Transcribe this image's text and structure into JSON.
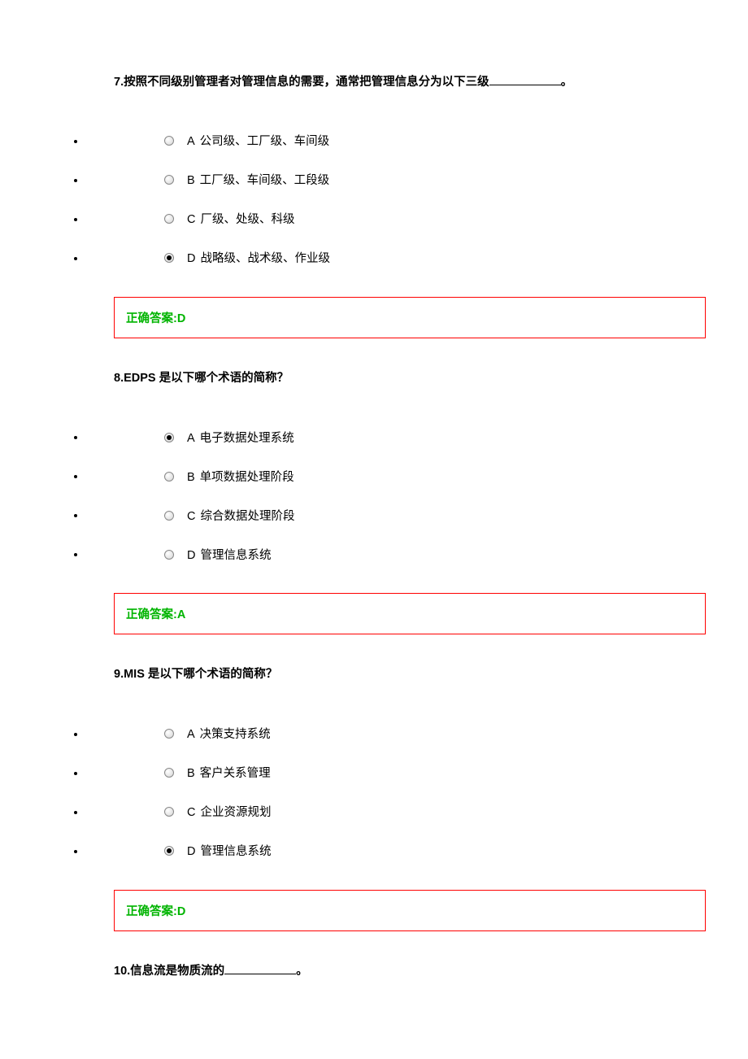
{
  "answerLabel": "正确答案:",
  "questions": [
    {
      "num": "7.",
      "stem_pre": "按照不同级别管理者对管理信息的需要，通常把管理信息分为以下三级",
      "blank": true,
      "stem_post": "。",
      "options": [
        {
          "letter": "A",
          "text": "公司级、工厂级、车间级",
          "selected": false
        },
        {
          "letter": "B",
          "text": "工厂级、车间级、工段级",
          "selected": false
        },
        {
          "letter": "C",
          "text": "厂级、处级、科级",
          "selected": false
        },
        {
          "letter": "D",
          "text": "战略级、战术级、作业级",
          "selected": true
        }
      ],
      "answer": "D"
    },
    {
      "num": "8.",
      "stem_pre": "EDPS 是以下哪个术语的简称？",
      "blank": false,
      "stem_post": "",
      "options": [
        {
          "letter": "A",
          "text": "电子数据处理系统",
          "selected": true
        },
        {
          "letter": "B",
          "text": "单项数据处理阶段",
          "selected": false
        },
        {
          "letter": "C",
          "text": "综合数据处理阶段",
          "selected": false
        },
        {
          "letter": "D",
          "text": "管理信息系统",
          "selected": false
        }
      ],
      "answer": "A"
    },
    {
      "num": "9.",
      "stem_pre": "MIS 是以下哪个术语的简称？",
      "blank": false,
      "stem_post": "",
      "options": [
        {
          "letter": "A",
          "text": "决策支持系统",
          "selected": false
        },
        {
          "letter": "B",
          "text": "客户关系管理",
          "selected": false
        },
        {
          "letter": "C",
          "text": "企业资源规划",
          "selected": false
        },
        {
          "letter": "D",
          "text": "管理信息系统",
          "selected": true
        }
      ],
      "answer": "D"
    },
    {
      "num": "10.",
      "stem_pre": "信息流是物质流的",
      "blank": true,
      "stem_post": "。",
      "options": [],
      "answer": null
    }
  ]
}
